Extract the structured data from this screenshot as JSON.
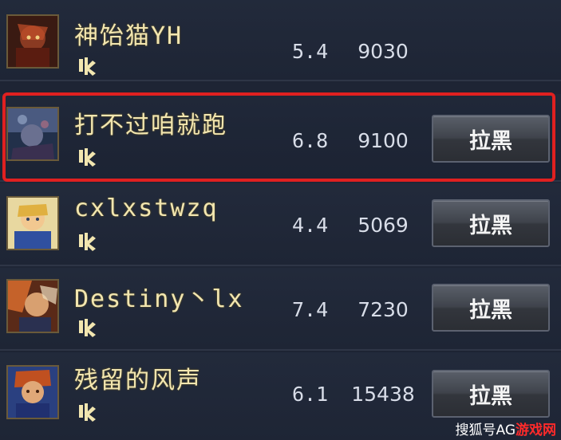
{
  "players": [
    {
      "name": "神饴猫YH",
      "score": "5.4",
      "power": "9030",
      "block_label": "",
      "avatar_icon": "hero-avatar-icon"
    },
    {
      "name": "打不过咱就跑",
      "score": "6.8",
      "power": "9100",
      "block_label": "拉黑",
      "avatar_icon": "hero-avatar-icon"
    },
    {
      "name": "cxlxstwzq",
      "score": "4.4",
      "power": "5069",
      "block_label": "拉黑",
      "avatar_icon": "hero-avatar-icon"
    },
    {
      "name": "Destiny丶lx",
      "score": "7.4",
      "power": "7230",
      "block_label": "拉黑",
      "avatar_icon": "hero-avatar-icon"
    },
    {
      "name": "残留的风声",
      "score": "6.1",
      "power": "15438",
      "block_label": "拉黑",
      "avatar_icon": "hero-avatar-icon"
    }
  ],
  "grade_icon": "rank-badge-icon",
  "watermark": {
    "prefix": "搜狐号",
    "middle": "AG",
    "suffix": "游戏网"
  },
  "colors": {
    "highlight_border": "#e02020",
    "name_text": "#f2e6b0",
    "stat_text": "#d8dde8"
  }
}
